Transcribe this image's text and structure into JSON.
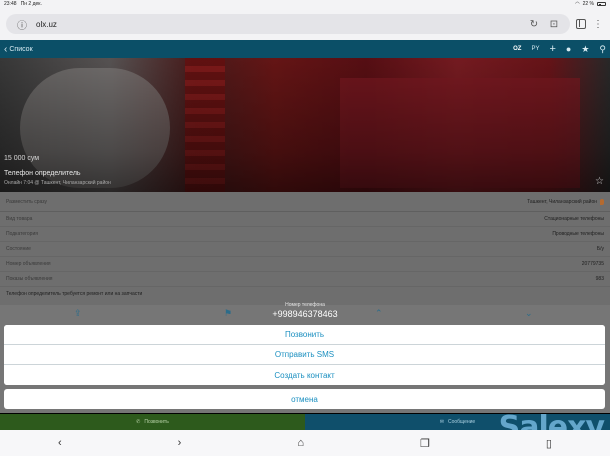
{
  "status_bar": {
    "time": "23:48",
    "date": "Пн 2 дек.",
    "battery": "22 %"
  },
  "address_bar": {
    "url": "olx.uz",
    "reload_icon": "reload-icon",
    "bookmark_icon": "bookmark-icon"
  },
  "app_header": {
    "back_label": "Список",
    "languages": [
      "OZ",
      "PY"
    ],
    "icons": [
      "plus-icon",
      "user-icon",
      "star-icon",
      "search-icon"
    ]
  },
  "listing": {
    "price": "15 000 сум",
    "title": "Телефон определитель",
    "meta": "Онлайн 7:04 @ Ташкент, Чиланзарский район",
    "location_label": "Разместить сразу",
    "location_value": "Ташкент, Чиланзарский район",
    "details": [
      {
        "key": "Вид товара",
        "value": "Стационарные телефоны"
      },
      {
        "key": "Подкатегория",
        "value": "Проводные телефоны"
      },
      {
        "key": "Состояние",
        "value": "Б/у"
      },
      {
        "key": "Номер объявления",
        "value": "20779735"
      },
      {
        "key": "Показы объявления",
        "value": "983"
      }
    ],
    "description": "Телефон определитель требуется ремонт или на запчасти"
  },
  "action_sheet": {
    "caption": "Номер телефона",
    "phone": "+998946378463",
    "buttons": [
      "Позвонить",
      "Отправить SMS",
      "Создать контакт"
    ],
    "cancel": "отмена"
  },
  "bottom_bar": {
    "call": "Позвонить",
    "message": "Сообщение"
  },
  "watermark": "Salexy",
  "colors": {
    "header": "#0b4f67",
    "accent": "#1a8fc0",
    "call_bar": "#2d5a1c",
    "msg_bar": "#0f4f6b"
  }
}
